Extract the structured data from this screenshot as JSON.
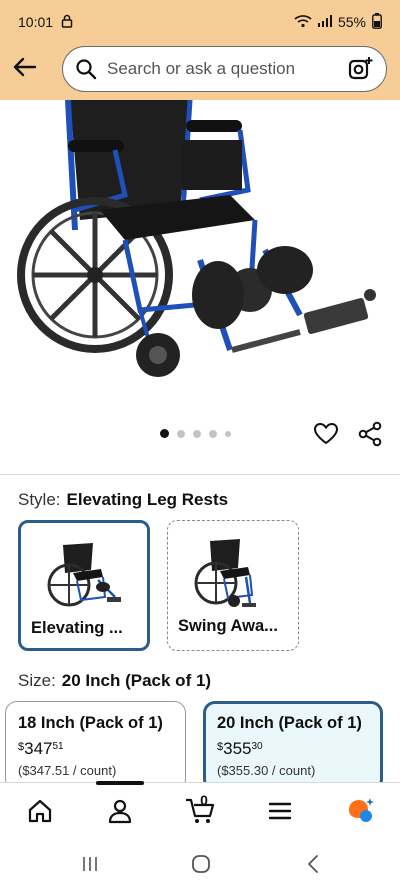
{
  "status_bar": {
    "time": "10:01",
    "battery": "55%"
  },
  "search": {
    "placeholder": "Search or ask a question"
  },
  "carousel": {
    "dot_count": 5,
    "active_index": 0
  },
  "style": {
    "label": "Style:",
    "selected_value": "Elevating Leg Rests",
    "options": [
      {
        "label": "Elevating ...",
        "selected": true
      },
      {
        "label": "Swing Awa...",
        "selected": false
      }
    ]
  },
  "size": {
    "label": "Size:",
    "selected_value": "20 Inch (Pack of 1)",
    "options": [
      {
        "title": "18 Inch (Pack of 1)",
        "currency": "$",
        "price_whole": "347",
        "price_fraction": "51",
        "unit_price": "($347.51 / count)",
        "selected": false
      },
      {
        "title": "20 Inch (Pack of 1)",
        "currency": "$",
        "price_whole": "355",
        "price_fraction": "30",
        "unit_price": "($355.30 / count)",
        "selected": true
      }
    ]
  },
  "bottom_nav": {
    "cart_count": "0",
    "icons": [
      "home-icon",
      "account-icon",
      "cart-icon",
      "menu-icon",
      "rufus-icon"
    ]
  },
  "colors": {
    "header_bg": "#f6cd96",
    "selected_border": "#2a5d87",
    "selected_bg": "#eaf7fb",
    "wheelchair_blue": "#1f4fb8"
  }
}
